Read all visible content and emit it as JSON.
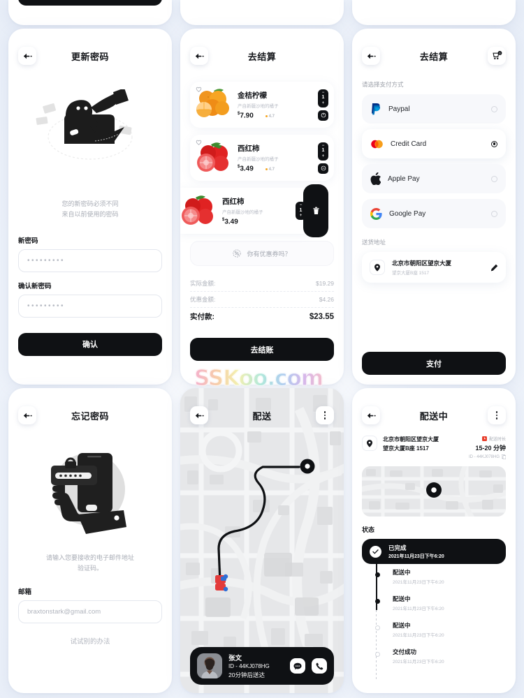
{
  "screens": {
    "update_password": {
      "title": "更新密码",
      "back_icon": "back-arrow-icon",
      "illustration": "person-megaphone-illustration",
      "hint_line1": "您的新密码必须不同",
      "hint_line2": "来自以前使用的密码",
      "new_password_label": "新密码",
      "new_password_value": "•••••••••",
      "confirm_password_label": "确认新密码",
      "confirm_password_value": "•••••••••",
      "submit_label": "确认"
    },
    "checkout_cart": {
      "title": "去结算",
      "back_icon": "back-arrow-icon",
      "items": [
        {
          "name": "金桔柠檬",
          "desc": "产自新疆沙地的橘子",
          "price": "7.90",
          "currency": "$",
          "rating": "4.7",
          "qty": "1",
          "image": "oranges-image",
          "favorite_icon": "heart-outline-icon",
          "action_icon": "power-icon",
          "swiped": false
        },
        {
          "name": "西红柿",
          "desc": "产自新疆沙地的橘子",
          "price": "3.49",
          "currency": "$",
          "rating": "4.7",
          "qty": "1",
          "image": "tomatoes-image",
          "favorite_icon": "heart-outline-icon",
          "action_icon": "minus-circle-icon",
          "swiped": false
        },
        {
          "name": "西红柿",
          "desc": "产自新疆沙地的橘子",
          "price": "3.49",
          "currency": "$",
          "rating": "",
          "qty": "1",
          "image": "tomatoes-image",
          "favorite_icon": "",
          "action_icon": "trash-icon",
          "swiped": true
        }
      ],
      "coupon_text": "你有优惠券吗？",
      "coupon_icon": "percent-badge-icon",
      "summary": [
        {
          "key": "实际金额:",
          "value": "$19.29",
          "total": false
        },
        {
          "key": "优惠金额:",
          "value": "$4.26",
          "total": false
        },
        {
          "key": "实付款:",
          "value": "$23.55",
          "total": true
        }
      ],
      "submit_label": "去结账"
    },
    "payment": {
      "title": "去结算",
      "back_icon": "back-arrow-icon",
      "cart_icon": "cart-badge-icon",
      "cart_badge": "3",
      "section_methods": "请选择支付方式",
      "methods": [
        {
          "name": "Paypal",
          "icon": "paypal-icon",
          "selected": false
        },
        {
          "name": "Credit Card",
          "icon": "mastercard-icon",
          "selected": true
        },
        {
          "name": "Apple Pay",
          "icon": "apple-icon",
          "selected": false
        },
        {
          "name": "Google Pay",
          "icon": "google-icon",
          "selected": false
        }
      ],
      "section_address": "送货地址",
      "address_line1": "北京市朝阳区望京大厦",
      "address_line2": "望京大厦B座 1517",
      "address_pin_icon": "map-pin-icon",
      "edit_icon": "pencil-icon",
      "submit_label": "支付"
    },
    "forgot_password": {
      "title": "忘记密码",
      "back_icon": "back-arrow-icon",
      "illustration": "hand-phone-lock-illustration",
      "hint_line1": "请输入您要接收的电子邮件地址",
      "hint_line2": "验证码。",
      "email_label": "邮箱",
      "email_placeholder": "braxtonstark@gmail.com",
      "alt_link": "试试别的办法"
    },
    "delivery_map": {
      "title": "配送",
      "back_icon": "back-arrow-icon",
      "menu_icon": "more-vertical-icon",
      "destination_icon": "map-pin-icon",
      "vehicle_icon": "delivery-truck-icon",
      "driver_name": "张文",
      "driver_id": "ID - 44KJ078HG",
      "driver_eta": "20分钟后送达",
      "avatar": "driver-avatar",
      "chat_icon": "chat-bubble-icon",
      "call_icon": "phone-icon"
    },
    "delivering": {
      "title": "配送中",
      "back_icon": "back-arrow-icon",
      "menu_icon": "more-vertical-icon",
      "address_line1": "北京市朝阳区望京大厦",
      "address_line2": "望京大厦B座 1517",
      "address_pin_icon": "map-pin-icon",
      "eta_label": "配送时长",
      "eta_icon": "clock-badge-icon",
      "eta_value": "15-20 分钟",
      "order_id": "ID - 44KJ078HG",
      "copy_icon": "copy-icon",
      "map_pin_icon": "map-pin-icon",
      "status_label": "状态",
      "timeline": [
        {
          "title": "已完成",
          "time": "2021年11月23日下午6:20",
          "state": "active",
          "icon": "check-circle-icon"
        },
        {
          "title": "配送中",
          "time": "2021年11月23日下午6:20",
          "state": "done",
          "icon": ""
        },
        {
          "title": "配送中",
          "time": "2021年11月23日下午6:20",
          "state": "done",
          "icon": ""
        },
        {
          "title": "配送中",
          "time": "2021年11月23日下午6:20",
          "state": "pending",
          "icon": ""
        },
        {
          "title": "交付成功",
          "time": "2021年11月23日下午6:20",
          "state": "pending",
          "icon": ""
        }
      ]
    }
  },
  "watermark": {
    "text": "SSKoo.com"
  },
  "colors": {
    "ink": "#0f1114",
    "page_bg": "#eef2f9",
    "muted": "#b0b4bd",
    "accent_orange": "#f5a623",
    "paypal": "#0070ba",
    "mastercard_red": "#eb001b",
    "mastercard_yellow": "#f79e1b",
    "google_blue": "#4285f4"
  }
}
